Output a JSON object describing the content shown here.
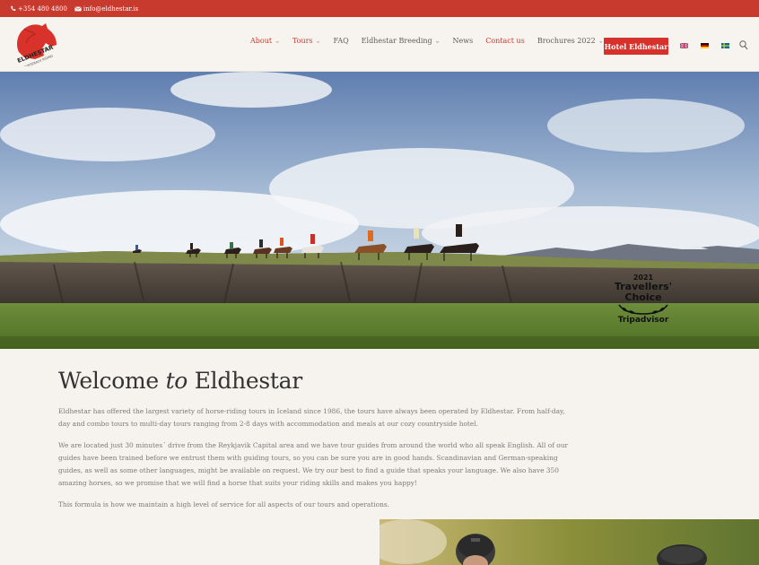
{
  "topbar": {
    "phone": "+354 480 4800",
    "email": "info@eldhestar.is",
    "phone_icon": "phone-icon",
    "email_icon": "envelope-icon",
    "bg_color": "#c8392e"
  },
  "header": {
    "logo_alt": "ELDHESTAR",
    "nav": [
      {
        "label": "About",
        "dropdown": true,
        "active": true
      },
      {
        "label": "Tours",
        "dropdown": true,
        "active": true
      },
      {
        "label": "FAQ",
        "dropdown": false,
        "active": false
      },
      {
        "label": "Eldhestar Breeding",
        "dropdown": true,
        "active": false
      },
      {
        "label": "News",
        "dropdown": false,
        "active": false
      },
      {
        "label": "Contact us",
        "dropdown": false,
        "active": true
      },
      {
        "label": "Brochures 2022",
        "dropdown": true,
        "active": false
      }
    ],
    "hotel_button": "Hotel Eldhestar",
    "languages": [
      "flag-uk-icon",
      "flag-de-icon",
      "flag-se-icon"
    ],
    "search_icon": "search-icon",
    "accent": "#d6312a"
  },
  "hero": {
    "badge_year": "2021",
    "badge_line1": "Travellers'",
    "badge_line2": "Choice",
    "badge_brand": "Tripadvisor"
  },
  "main": {
    "title_pre": "Welcome",
    "title_em": "to",
    "title_post": "Eldhestar",
    "paragraphs": [
      "Eldhestar has offered the largest variety of horse-riding tours in Iceland since 1986, the tours have always been operated by Eldhestar. From half-day, day and combo tours to multi-day tours ranging from 2-8 days with accommodation and meals at our cozy countryside hotel.",
      "We are located just 30 minutes´ drive from the Reykjavik Capital area and we have tour guides from around the world who all speak English. All of our guides have been trained before we entrust them with guiding tours, so you can be sure you are in good hands. Scandinavian and German-speaking guides, as well as some other languages, might be available on request. We try our best to find a guide that speaks your language. We also have 350 amazing horses, so we promise that we will find a horse that suits your riding skills and makes you happy!",
      "This formula is how we maintain a high level of service for all aspects of our tours and operations."
    ]
  }
}
